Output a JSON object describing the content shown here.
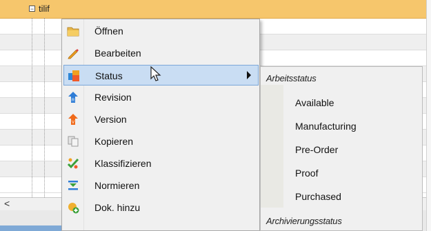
{
  "grid": {
    "node_label": "tilif",
    "toggle_symbol": "−",
    "scroll_left": "<"
  },
  "menu": {
    "items": [
      {
        "label": "Öffnen",
        "icon": "folder-icon"
      },
      {
        "label": "Bearbeiten",
        "icon": "pencil-icon"
      },
      {
        "label": "Status",
        "icon": "status-icon",
        "has_submenu": true
      },
      {
        "label": "Revision",
        "icon": "revision-icon"
      },
      {
        "label": "Version",
        "icon": "version-icon"
      },
      {
        "label": "Kopieren",
        "icon": "copy-icon"
      },
      {
        "label": "Klassifizieren",
        "icon": "classify-icon"
      },
      {
        "label": "Normieren",
        "icon": "normalize-icon"
      },
      {
        "label": "Dok. hinzu",
        "icon": "add-document-icon"
      }
    ]
  },
  "submenu": {
    "group1_header": "Arbeitsstatus",
    "items": [
      "Available",
      "Manufacturing",
      "Pre-Order",
      "Proof",
      "Purchased"
    ],
    "group2_header": "Archivierungsstatus"
  },
  "colors": {
    "header_row": "#f6c66c",
    "hover_item": "#c9ddf3",
    "hover_border": "#7aa6d8"
  }
}
